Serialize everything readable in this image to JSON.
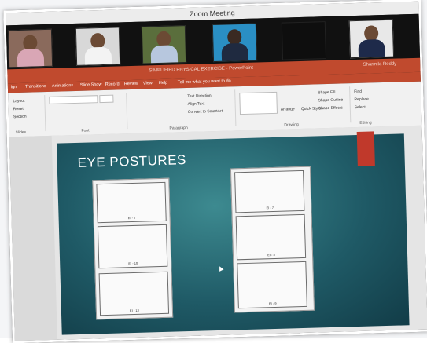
{
  "window": {
    "title": "Zoom Meeting"
  },
  "participants": [
    {
      "id": "p1"
    },
    {
      "id": "p2"
    },
    {
      "id": "p3"
    },
    {
      "id": "p4"
    },
    {
      "id": "p5"
    },
    {
      "id": "p6"
    }
  ],
  "ribbon": {
    "doc_title": "SIMPLIFIED  PHYSICAL EXERCISE - PowerPoint",
    "user": "Sharmila Reddy",
    "tabs": [
      "ign",
      "Transitions",
      "Animations",
      "Slide Show",
      "Record",
      "Review",
      "View",
      "Help"
    ],
    "tell_me": "Tell me what you want to do",
    "groups": {
      "slides": "Slides",
      "font": "Font",
      "paragraph": "Paragraph",
      "drawing": "Drawing",
      "editing": "Editing"
    },
    "commands": {
      "layout": "Layout",
      "reset": "Reset",
      "section": "Section",
      "text_direction": "Text Direction",
      "align_text": "Align Text",
      "convert_smartart": "Convert to SmartArt",
      "arrange": "Arrange",
      "quick_styles": "Quick Styles",
      "shape_fill": "Shape Fill",
      "shape_outline": "Shape Outline",
      "shape_effects": "Shape Effects",
      "find": "Find",
      "replace": "Replace",
      "select": "Select"
    }
  },
  "slide": {
    "title": "EYE POSTURES",
    "left_captions": [
      "EI - 7",
      "EI - 10",
      "EI - 13"
    ],
    "right_captions": [
      "EI - 7",
      "EI - 8",
      "EI - 9"
    ]
  }
}
